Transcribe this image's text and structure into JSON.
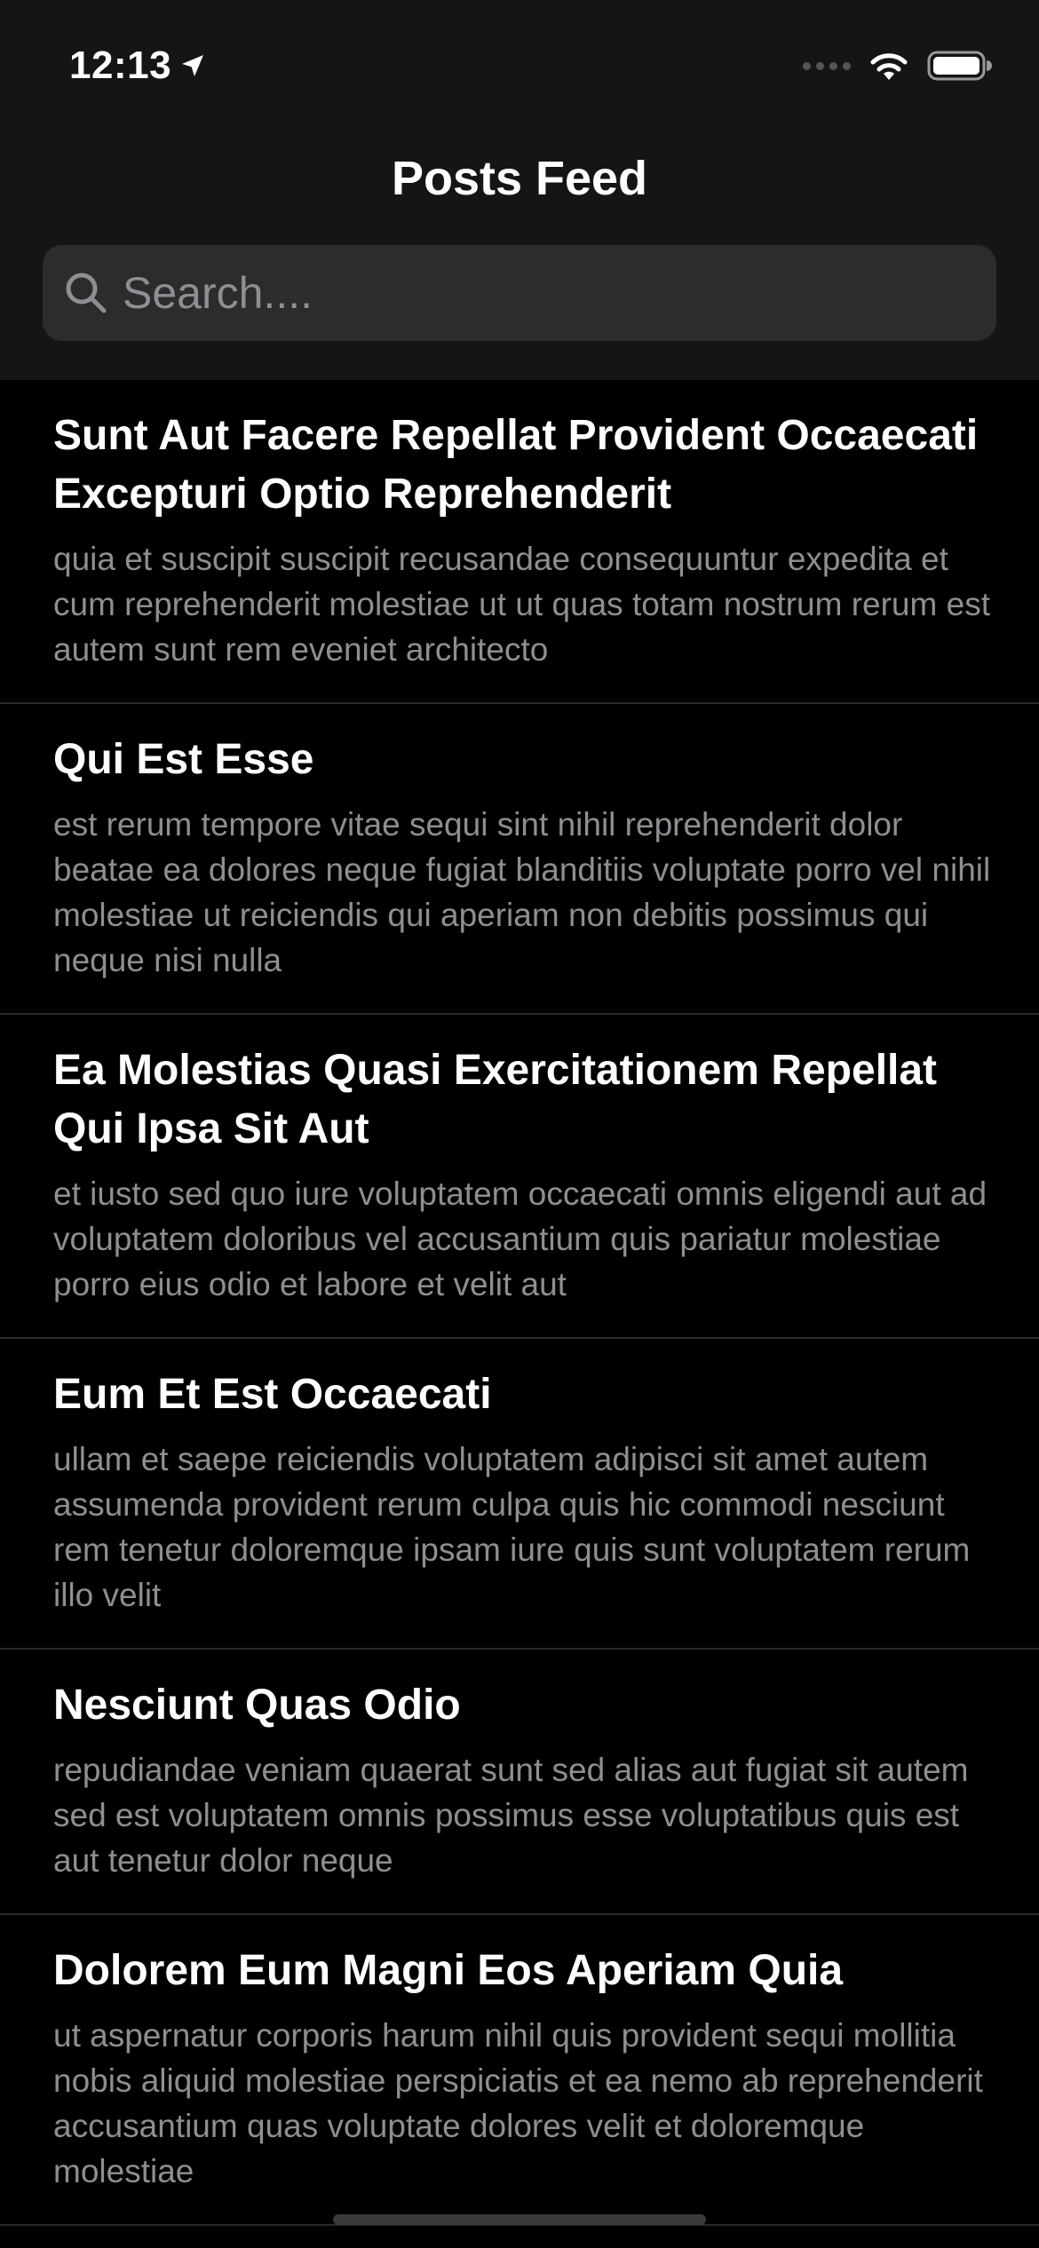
{
  "status_bar": {
    "time": "12:13",
    "location_icon": "location-arrow-icon",
    "signal_icon": "cellular-signal-icon",
    "wifi_icon": "wifi-icon",
    "battery_icon": "battery-full-icon"
  },
  "nav": {
    "title": "Posts Feed"
  },
  "search": {
    "placeholder": "Search....",
    "value": "",
    "icon": "magnifying-glass-icon"
  },
  "posts": [
    {
      "title": "Sunt Aut Facere Repellat Provident Occaecati Excepturi Optio Reprehenderit",
      "body": "quia et suscipit suscipit recusandae consequuntur expedita et cum reprehenderit molestiae ut ut quas totam nostrum rerum est autem sunt rem eveniet architecto"
    },
    {
      "title": "Qui Est Esse",
      "body": "est rerum tempore vitae sequi sint nihil reprehenderit dolor beatae ea dolores neque fugiat blanditiis voluptate porro vel nihil molestiae ut reiciendis qui aperiam non debitis possimus qui neque nisi nulla"
    },
    {
      "title": "Ea Molestias Quasi Exercitationem Repellat Qui Ipsa Sit Aut",
      "body": "et iusto sed quo iure voluptatem occaecati omnis eligendi aut ad voluptatem doloribus vel accusantium quis pariatur molestiae porro eius odio et labore et velit aut"
    },
    {
      "title": "Eum Et Est Occaecati",
      "body": "ullam et saepe reiciendis voluptatem adipisci sit amet autem assumenda provident rerum culpa quis hic commodi nesciunt rem tenetur doloremque ipsam iure quis sunt voluptatem rerum illo velit"
    },
    {
      "title": "Nesciunt Quas Odio",
      "body": "repudiandae veniam quaerat sunt sed alias aut fugiat sit autem sed est voluptatem omnis possimus esse voluptatibus quis est aut tenetur dolor neque"
    },
    {
      "title": "Dolorem Eum Magni Eos Aperiam Quia",
      "body": "ut aspernatur corporis harum nihil quis provident sequi mollitia nobis aliquid molestiae perspiciatis et ea nemo ab reprehenderit accusantium quas voluptate dolores velit et doloremque molestiae"
    }
  ],
  "colors": {
    "background": "#000000",
    "header_background": "#151515",
    "search_background": "#2c2c2e",
    "title_text": "#ffffff",
    "body_text": "#8e8e93",
    "divider": "#2a2a2a"
  }
}
